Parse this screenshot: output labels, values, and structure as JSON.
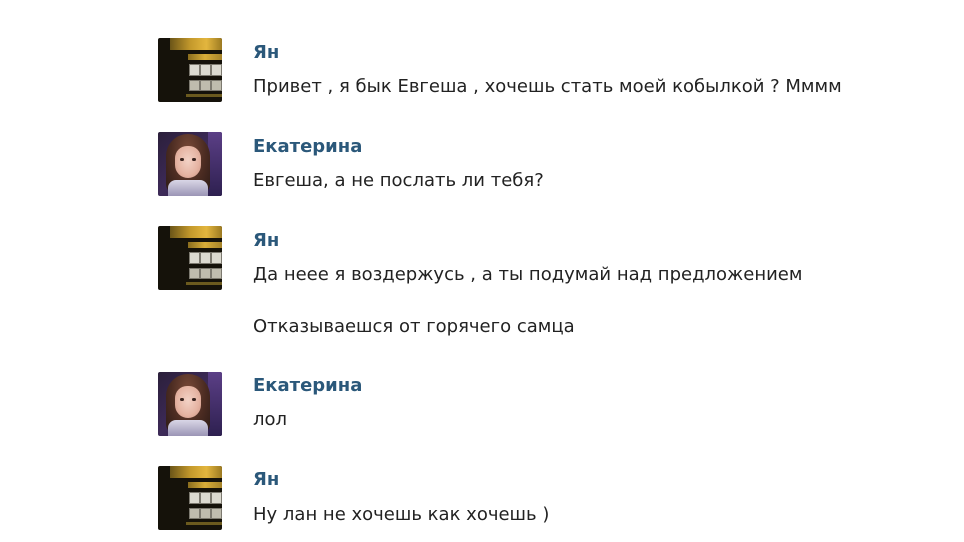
{
  "messages": [
    {
      "author": "Ян",
      "avatar_icon": "yan-avatar-icon",
      "lines": [
        "Привет , я бык Евгеша , хочешь стать моей кобылкой ? Мммм"
      ]
    },
    {
      "author": "Екатерина",
      "avatar_icon": "ekaterina-avatar-icon",
      "lines": [
        "Евгеша, а не послать ли тебя?"
      ]
    },
    {
      "author": "Ян",
      "avatar_icon": "yan-avatar-icon",
      "lines": [
        "Да неее я воздержусь , а ты подумай над предложением",
        "Отказываешся от горячего самца"
      ]
    },
    {
      "author": "Екатерина",
      "avatar_icon": "ekaterina-avatar-icon",
      "lines": [
        "лол"
      ]
    },
    {
      "author": "Ян",
      "avatar_icon": "yan-avatar-icon",
      "lines": [
        "Ну лан не хочешь как хочешь )"
      ]
    }
  ],
  "colors": {
    "author_name": "#2b587a",
    "message_text": "#222222",
    "background": "#ffffff"
  }
}
